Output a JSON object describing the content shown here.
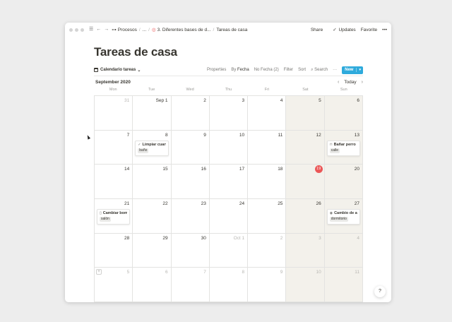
{
  "topbar": {
    "breadcrumbs": [
      {
        "label": "Procesos",
        "icon": "flow-icon",
        "glyph": "⊶"
      },
      {
        "label": "...",
        "icon": "",
        "glyph": ""
      },
      {
        "label": "3. Diferentes bases de d...",
        "icon": "target-icon",
        "glyph": "◎"
      },
      {
        "label": "Tareas de casa",
        "icon": "",
        "glyph": ""
      }
    ],
    "share_label": "Share",
    "updates_label": "Updates",
    "favorite_label": "Favorite",
    "more_label": "•••",
    "updates_check": "✓"
  },
  "page": {
    "title": "Tareas de casa"
  },
  "viewbar": {
    "view_name": "Calendario tareas",
    "view_caret": "⌄",
    "properties_label": "Properties",
    "by_prefix": "By",
    "by_value": "Fecha",
    "nofecha_label": "No Fecha (2)",
    "filter_label": "Filter",
    "sort_label": "Sort",
    "search_label": "Search",
    "search_glyph": "⌕",
    "more_label": "···",
    "new_label": "New",
    "new_arrow": "▾"
  },
  "calendar": {
    "month": "September 2020",
    "today_label": "Today",
    "prev_glyph": "‹",
    "next_glyph": "›",
    "weekdays": [
      "Mon",
      "Tue",
      "Wed",
      "Thu",
      "Fri",
      "Sat",
      "Sun"
    ],
    "weeks": [
      [
        {
          "d": "31",
          "m": true
        },
        {
          "d": "Sep 1"
        },
        {
          "d": "2"
        },
        {
          "d": "3"
        },
        {
          "d": "4"
        },
        {
          "d": "5"
        },
        {
          "d": "6"
        }
      ],
      [
        {
          "d": "7"
        },
        {
          "d": "8",
          "card": {
            "icon": "✓",
            "title": "Limpiar cuart...",
            "tag": "baño"
          }
        },
        {
          "d": "9"
        },
        {
          "d": "10"
        },
        {
          "d": "11"
        },
        {
          "d": "12"
        },
        {
          "d": "13",
          "card": {
            "icon": "⊓",
            "title": "Bañar perro",
            "tag": "calle"
          }
        }
      ],
      [
        {
          "d": "14"
        },
        {
          "d": "15"
        },
        {
          "d": "16"
        },
        {
          "d": "17"
        },
        {
          "d": "18"
        },
        {
          "d": "19",
          "today": true
        },
        {
          "d": "20"
        }
      ],
      [
        {
          "d": "21",
          "card": {
            "icon": "▯",
            "title": "Cambiar bom...",
            "tag": "salón"
          }
        },
        {
          "d": "22"
        },
        {
          "d": "23"
        },
        {
          "d": "24"
        },
        {
          "d": "25"
        },
        {
          "d": "26"
        },
        {
          "d": "27",
          "card": {
            "icon": "◉",
            "title": "Cambio de ar...",
            "tag": "dormitorio"
          }
        }
      ],
      [
        {
          "d": "28"
        },
        {
          "d": "29"
        },
        {
          "d": "30"
        },
        {
          "d": "Oct 1",
          "m": true
        },
        {
          "d": "2",
          "m": true
        },
        {
          "d": "3",
          "m": true
        },
        {
          "d": "4",
          "m": true
        }
      ],
      [
        {
          "d": "5",
          "m": true,
          "add": true
        },
        {
          "d": "6",
          "m": true
        },
        {
          "d": "7",
          "m": true
        },
        {
          "d": "8",
          "m": true
        },
        {
          "d": "9",
          "m": true
        },
        {
          "d": "10",
          "m": true
        },
        {
          "d": "11",
          "m": true
        }
      ]
    ]
  },
  "help": {
    "label": "?"
  },
  "icons": {
    "add": "+",
    "menu": "☰",
    "back": "←",
    "forward": "→"
  }
}
